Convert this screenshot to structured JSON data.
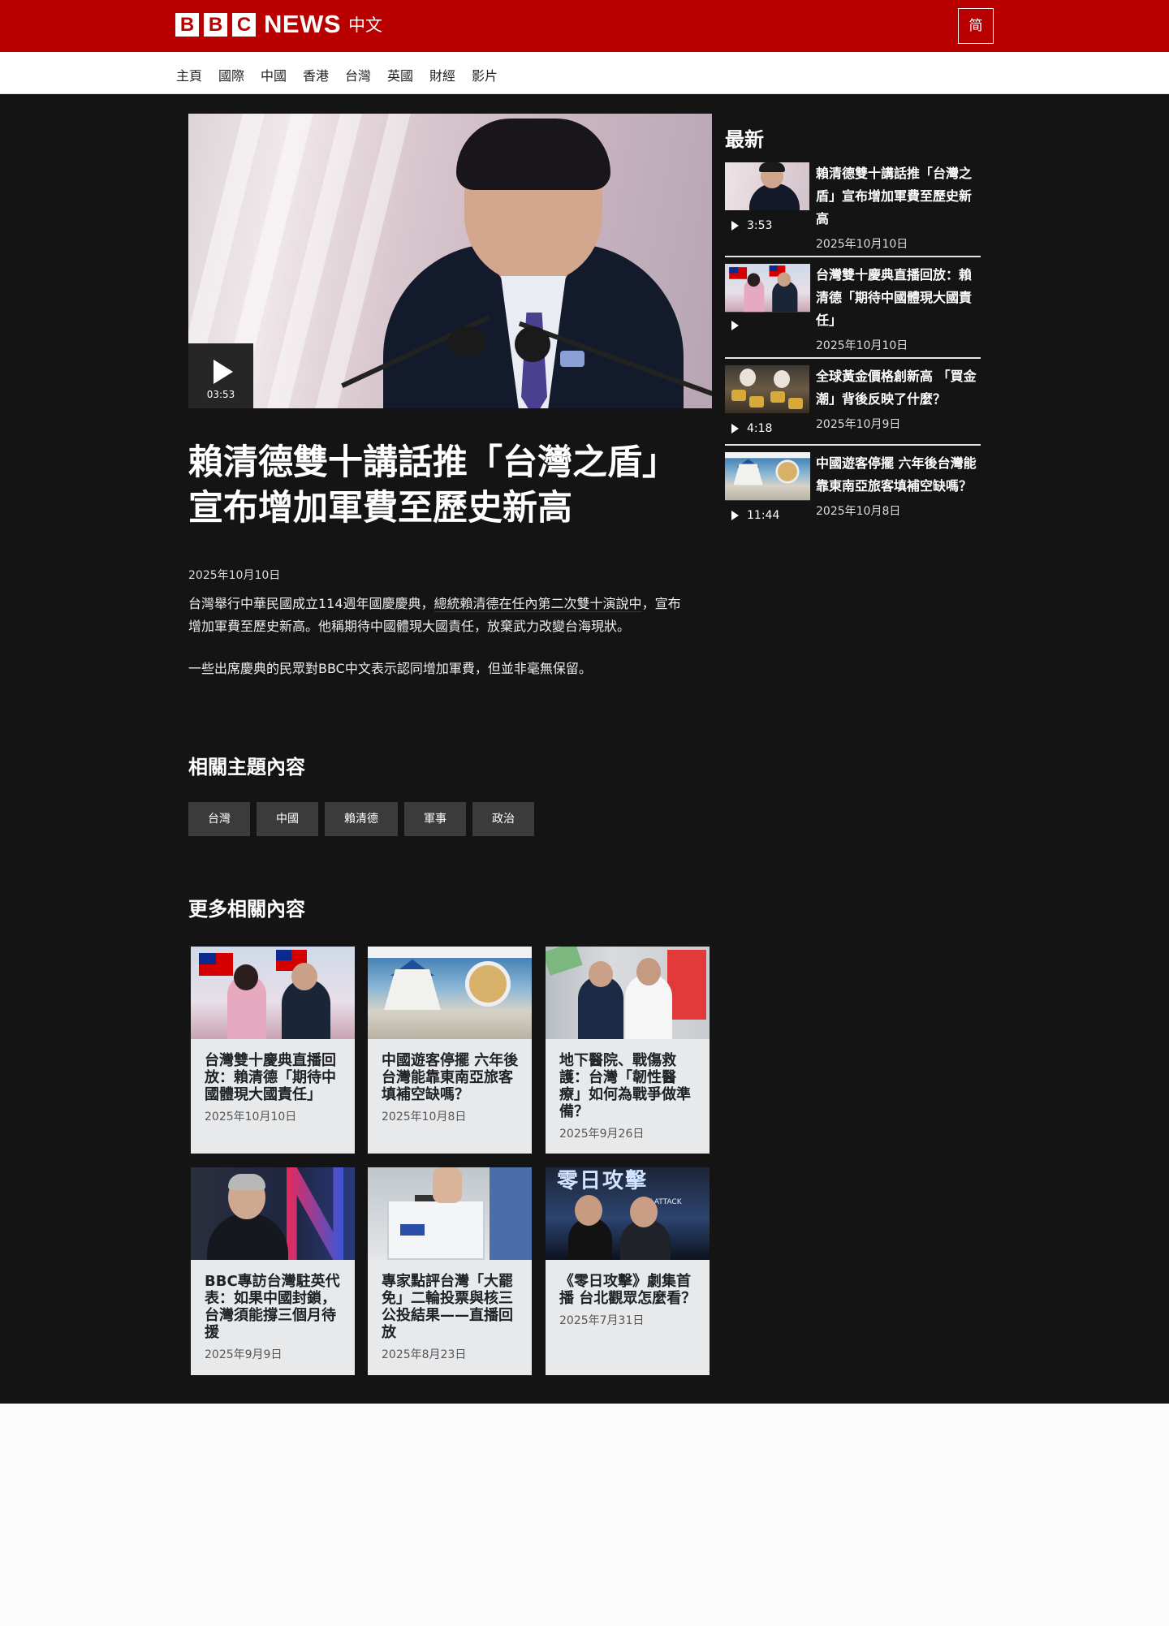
{
  "header": {
    "brand_blocks": [
      "B",
      "B",
      "C"
    ],
    "brand_news": "NEWS",
    "brand_lang": "中文",
    "script_toggle": "简"
  },
  "nav": {
    "items": [
      "主頁",
      "國際",
      "中國",
      "香港",
      "台灣",
      "英國",
      "財經",
      "影片"
    ]
  },
  "hero": {
    "duration": "03:53",
    "headline": "賴清德雙十講話推「台灣之盾」宣布增加軍費至歷史新高",
    "date": "2025年10月10日",
    "summary_a": "台灣舉行中華民國成立114週年國慶慶典，",
    "summary_link": "總統賴清德在任內第二次雙十演說中",
    "summary_b": "，宣布增加軍費至歷史新高。他稱期待中國體現大國責任，放棄武力改變台海現狀。",
    "summary2": "一些出席慶典的民眾對BBC中文表示認同增加軍費，但並非毫無保留。"
  },
  "topics": {
    "heading": "相關主題內容",
    "tags": [
      "台灣",
      "中國",
      "賴清德",
      "軍事",
      "政治"
    ]
  },
  "more": {
    "heading": "更多相關內容",
    "cards": [
      {
        "title": "台灣雙十慶典直播回放：賴清德「期待中國體現大國責任」",
        "date": "2025年10月10日"
      },
      {
        "title": "中國遊客停擺 六年後台灣能靠東南亞旅客填補空缺嗎？",
        "date": "2025年10月8日"
      },
      {
        "title": "地下醫院、戰傷救護：台灣「韌性醫療」如何為戰爭做準備？",
        "date": "2025年9月26日"
      },
      {
        "title": "BBC專訪台灣駐英代表：如果中國封鎖，台灣須能撐三個月待援",
        "date": "2025年9月9日"
      },
      {
        "title": "專家點評台灣「大罷免」二輪投票與核三公投結果——直播回放",
        "date": "2025年8月23日"
      },
      {
        "title": "《零日攻擊》劇集首播 台北觀眾怎麼看？",
        "date": "2025年7月31日"
      }
    ],
    "thumb_text": {
      "zero_title": "零日攻擊",
      "zero_sub": "AY ATTACK"
    }
  },
  "latest": {
    "heading": "最新",
    "items": [
      {
        "title": "賴清德雙十講話推「台灣之盾」宣布增加軍費至歷史新高",
        "duration": "3:53",
        "date": "2025年10月10日"
      },
      {
        "title": "台灣雙十慶典直播回放：賴清德「期待中國體現大國責任」",
        "duration": "",
        "date": "2025年10月10日"
      },
      {
        "title": "全球黃金價格創新高 「買金潮」背後反映了什麼？",
        "duration": "4:18",
        "date": "2025年10月9日"
      },
      {
        "title": "中國遊客停擺 六年後台灣能靠東南亞旅客填補空缺嗎？",
        "duration": "11:44",
        "date": "2025年10月8日"
      }
    ]
  },
  "colors": {
    "brand_red": "#b80000",
    "page_dark": "#141414",
    "card_bg": "#e8e9eb",
    "tag_bg": "#3b3b3b"
  }
}
